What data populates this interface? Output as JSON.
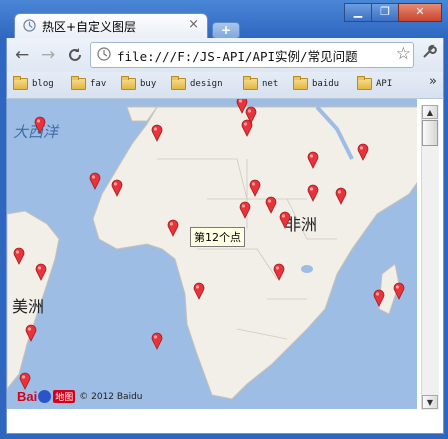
{
  "window": {
    "tab_title": "热区+自定义图层",
    "new_tab_label": "+",
    "tab_close_glyph": "×",
    "min_glyph": "▁",
    "restore_glyph": "❐",
    "close_glyph": "✕"
  },
  "toolbar": {
    "back_glyph": "←",
    "forward_glyph": "→",
    "reload_glyph": "C",
    "url": "file:///F:/JS-API/API实例/常见问题",
    "star_glyph": "☆",
    "wrench_glyph": "🔧"
  },
  "bookmarks": {
    "items": [
      "blog",
      "fav",
      "buy",
      "design",
      "net",
      "baidu",
      "API"
    ],
    "more_glyph": "»"
  },
  "map": {
    "labels": {
      "atlantic": "大西洋",
      "africa": "非洲",
      "america": "美洲"
    },
    "tooltip": "第12个点",
    "copyright": "© 2012 Baidu",
    "logo_text": "Bai",
    "logo_map": "地图",
    "marker_count": 28,
    "colors": {
      "ocean": "#9dbde4",
      "land": "#f2efe9",
      "marker": "#e8333a"
    }
  },
  "scrollbar": {
    "up_glyph": "▲",
    "down_glyph": "▼"
  }
}
